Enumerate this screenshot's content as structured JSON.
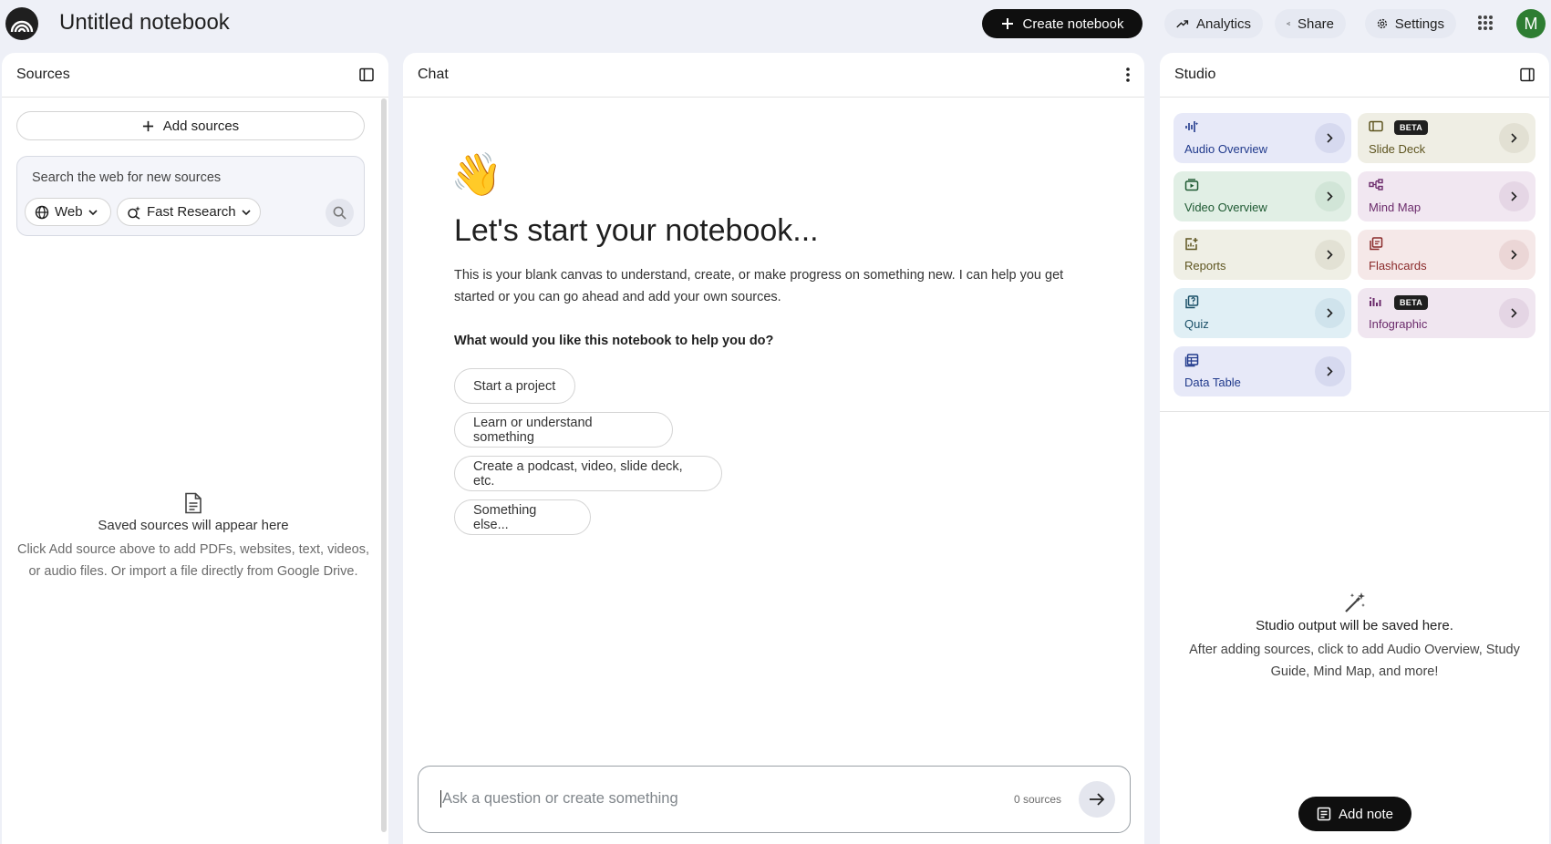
{
  "header": {
    "notebook_title": "Untitled notebook",
    "create_label": "Create notebook",
    "analytics_label": "Analytics",
    "share_label": "Share",
    "settings_label": "Settings",
    "avatar_initial": "M",
    "avatar_color": "#2e7d32"
  },
  "sources": {
    "title": "Sources",
    "add_label": "Add sources",
    "search_placeholder": "Search the web for new sources",
    "web_chip": "Web",
    "research_chip": "Fast Research",
    "empty_title": "Saved sources will appear here",
    "empty_desc": "Click Add source above to add PDFs, websites, text, videos, or audio files. Or import a file directly from Google Drive."
  },
  "chat": {
    "title": "Chat",
    "emoji": "👋",
    "heading": "Let's start your notebook...",
    "intro": "This is your blank canvas to understand, create, or make progress on something new. I can help you get started or you can go ahead and add your own sources.",
    "question": "What would you like this notebook to help you do?",
    "suggestions": [
      "Start a project",
      "Learn or understand something",
      "Create a podcast, video, slide deck, etc.",
      "Something else..."
    ],
    "input_placeholder": "Ask a question or create something",
    "source_count": "0 sources"
  },
  "studio": {
    "title": "Studio",
    "tiles": [
      {
        "label": "Audio Overview",
        "icon": "audio-waveform-icon"
      },
      {
        "label": "Slide Deck",
        "icon": "slides-icon",
        "badge": "BETA"
      },
      {
        "label": "Video Overview",
        "icon": "video-icon"
      },
      {
        "label": "Mind Map",
        "icon": "mind-map-icon"
      },
      {
        "label": "Reports",
        "icon": "report-icon"
      },
      {
        "label": "Flashcards",
        "icon": "flashcards-icon"
      },
      {
        "label": "Quiz",
        "icon": "quiz-icon"
      },
      {
        "label": "Infographic",
        "icon": "infographic-icon",
        "badge": "BETA"
      },
      {
        "label": "Data Table",
        "icon": "table-icon"
      }
    ],
    "empty_title": "Studio output will be saved here.",
    "empty_desc": "After adding sources, click to add Audio Overview, Study Guide, Mind Map, and more!",
    "add_note_label": "Add note"
  }
}
